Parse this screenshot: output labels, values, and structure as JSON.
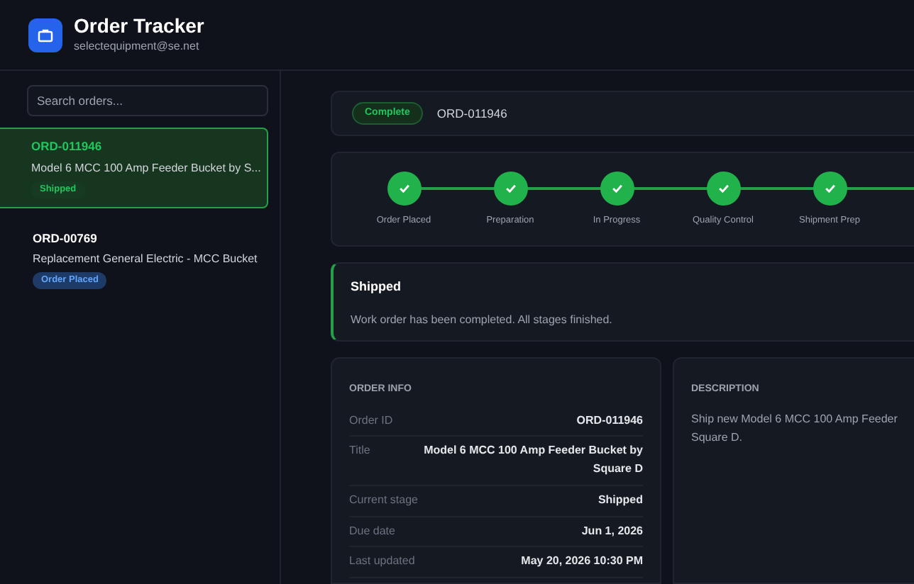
{
  "app": {
    "title": "Order Tracker",
    "email": "selectequipment@se.net"
  },
  "search": {
    "placeholder": "Search orders..."
  },
  "orders": [
    {
      "id": "ORD-011946",
      "title": "Model 6 MCC 100 Amp Feeder Bucket by S...",
      "status": "Shipped",
      "kind": "shipped",
      "selected": true
    },
    {
      "id": "ORD-00769",
      "title": "Replacement General Electric - MCC Bucket",
      "status": "Order Placed",
      "kind": "placed",
      "selected": false
    }
  ],
  "summary": {
    "badge": "Complete",
    "order_id": "ORD-011946"
  },
  "stages": [
    {
      "label": "Order Placed",
      "done": true
    },
    {
      "label": "Preparation",
      "done": true
    },
    {
      "label": "In Progress",
      "done": true
    },
    {
      "label": "Quality Control",
      "done": true
    },
    {
      "label": "Shipment Prep",
      "done": true
    }
  ],
  "notice": {
    "title": "Shipped",
    "message": "Work order has been completed. All stages finished."
  },
  "order_info": {
    "heading": "ORDER INFO",
    "rows": [
      {
        "label": "Order ID",
        "value": "ORD-011946"
      },
      {
        "label": "Title",
        "value": "Model 6 MCC 100 Amp Feeder Bucket by Square D"
      },
      {
        "label": "Current stage",
        "value": "Shipped"
      },
      {
        "label": "Due date",
        "value": "Jun 1, 2026"
      },
      {
        "label": "Last updated",
        "value": "May 20, 2026 10:30 PM"
      }
    ]
  },
  "description": {
    "heading": "DESCRIPTION",
    "lines": [
      "Ship new Model 6 MCC 100 Amp Feeder",
      "Square D."
    ]
  }
}
